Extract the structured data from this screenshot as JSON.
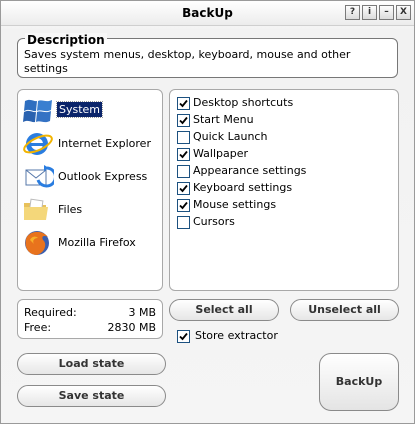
{
  "window": {
    "title": "BackUp",
    "controls": [
      "?",
      "i",
      "–",
      "X"
    ]
  },
  "description": {
    "heading": "Description",
    "text": "Saves system menus, desktop, keyboard, mouse and other settings"
  },
  "apps": [
    {
      "label": "System",
      "icon": "windows-flag-icon",
      "selected": true
    },
    {
      "label": "Internet Explorer",
      "icon": "internet-explorer-icon",
      "selected": false
    },
    {
      "label": "Outlook Express",
      "icon": "outlook-express-icon",
      "selected": false
    },
    {
      "label": "Files",
      "icon": "folder-icon",
      "selected": false
    },
    {
      "label": "Mozilla Firefox",
      "icon": "firefox-icon",
      "selected": false
    }
  ],
  "options": [
    {
      "label": "Desktop shortcuts",
      "checked": true
    },
    {
      "label": "Start Menu",
      "checked": true
    },
    {
      "label": "Quick Launch",
      "checked": false
    },
    {
      "label": "Wallpaper",
      "checked": true
    },
    {
      "label": "Appearance settings",
      "checked": false
    },
    {
      "label": "Keyboard settings",
      "checked": true
    },
    {
      "label": "Mouse settings",
      "checked": true
    },
    {
      "label": "Cursors",
      "checked": false
    }
  ],
  "stats": {
    "required_label": "Required:",
    "required_value": "3 MB",
    "free_label": "Free:",
    "free_value": "2830 MB"
  },
  "buttons": {
    "select_all": "Select all",
    "unselect_all": "Unselect all",
    "load_state": "Load state",
    "save_state": "Save state",
    "backup": "BackUp"
  },
  "store_extractor": {
    "label": "Store extractor",
    "checked": true
  },
  "colors": {
    "selection": "#0a246a",
    "checkbox_border": "#1c5180"
  }
}
